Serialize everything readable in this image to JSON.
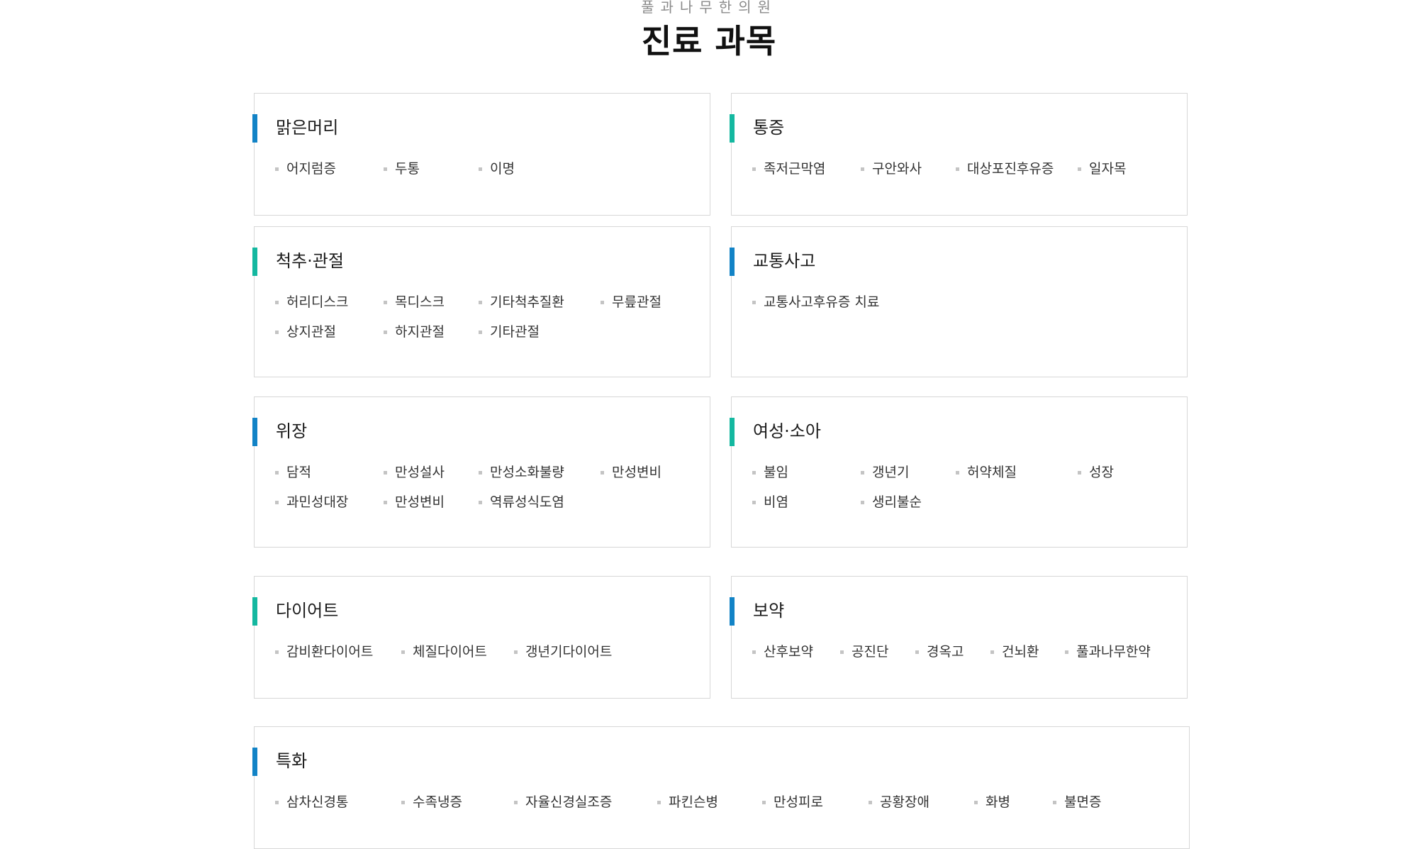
{
  "header": {
    "subtitle": "풀과나무한의원",
    "title": "진료 과목"
  },
  "colors": {
    "accent_blue": "#1283c6",
    "accent_teal": "#14b8a0",
    "border": "#d7d7d7",
    "bullet": "#c4c4c4"
  },
  "cards": [
    {
      "title": "맑은머리",
      "accent": "blue",
      "items": [
        "어지럼증",
        "두통",
        "이명"
      ]
    },
    {
      "title": "통증",
      "accent": "teal",
      "items": [
        "족저근막염",
        "구안와사",
        "대상포진후유증",
        "일자목"
      ]
    },
    {
      "title": "척추·관절",
      "accent": "teal",
      "items": [
        "허리디스크",
        "목디스크",
        "기타척추질환",
        "무릎관절",
        "상지관절",
        "하지관절",
        "기타관절"
      ]
    },
    {
      "title": "교통사고",
      "accent": "blue",
      "items": [
        "교통사고후유증 치료"
      ]
    },
    {
      "title": "위장",
      "accent": "blue",
      "items": [
        "담적",
        "만성설사",
        "만성소화불량",
        "만성변비",
        "과민성대장",
        "만성변비",
        "역류성식도염"
      ]
    },
    {
      "title": "여성·소아",
      "accent": "teal",
      "items": [
        "불임",
        "갱년기",
        "허약체질",
        "성장",
        "비염",
        "생리불순"
      ]
    },
    {
      "title": "다이어트",
      "accent": "teal",
      "items": [
        "감비환다이어트",
        "체질다이어트",
        "갱년기다이어트"
      ]
    },
    {
      "title": "보약",
      "accent": "blue",
      "items": [
        "산후보약",
        "공진단",
        "경옥고",
        "건뇌환",
        "풀과나무한약"
      ]
    },
    {
      "title": "특화",
      "accent": "blue",
      "items": [
        "삼차신경통",
        "수족냉증",
        "자율신경실조증",
        "파킨슨병",
        "만성피로",
        "공황장애",
        "화병",
        "불면증"
      ]
    }
  ]
}
